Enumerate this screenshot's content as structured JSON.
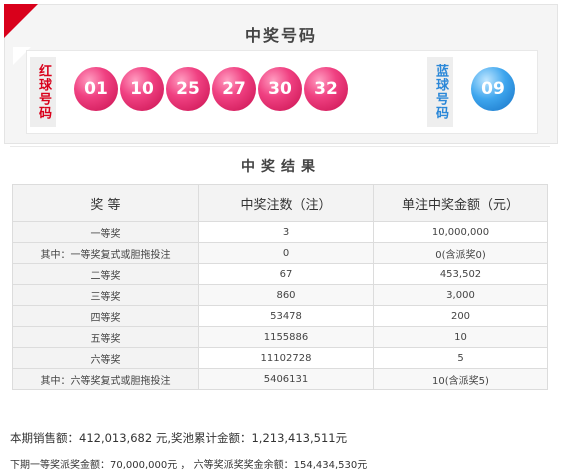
{
  "header": {
    "title": "中奖号码"
  },
  "balls": {
    "red_label": "红球号码",
    "blue_label": "蓝球号码",
    "red": [
      "01",
      "10",
      "25",
      "27",
      "30",
      "32"
    ],
    "blue": [
      "09"
    ]
  },
  "results": {
    "title": "中奖结果",
    "columns": [
      "奖 等",
      "中奖注数（注）",
      "单注中奖金额（元）"
    ],
    "rows": [
      [
        "一等奖",
        "3",
        "10,000,000"
      ],
      [
        "其中：一等奖复式或胆拖投注",
        "0",
        "0(含派奖0)"
      ],
      [
        "二等奖",
        "67",
        "453,502"
      ],
      [
        "三等奖",
        "860",
        "3,000"
      ],
      [
        "四等奖",
        "53478",
        "200"
      ],
      [
        "五等奖",
        "1155886",
        "10"
      ],
      [
        "六等奖",
        "11102728",
        "5"
      ],
      [
        "其中：六等奖复式或胆拖投注",
        "5406131",
        "10(含派奖5)"
      ]
    ]
  },
  "summary": {
    "line1": "本期销售额：412,013,682 元,奖池累计金额：1,213,413,511元",
    "line2": "下期一等奖派奖金额：70,000,000元 ， 六等奖派奖奖金余额：154,434,530元"
  },
  "colors": {
    "red_ball": "#e8306e",
    "blue_ball": "#2a8fdc",
    "brand": "#d9001b"
  }
}
